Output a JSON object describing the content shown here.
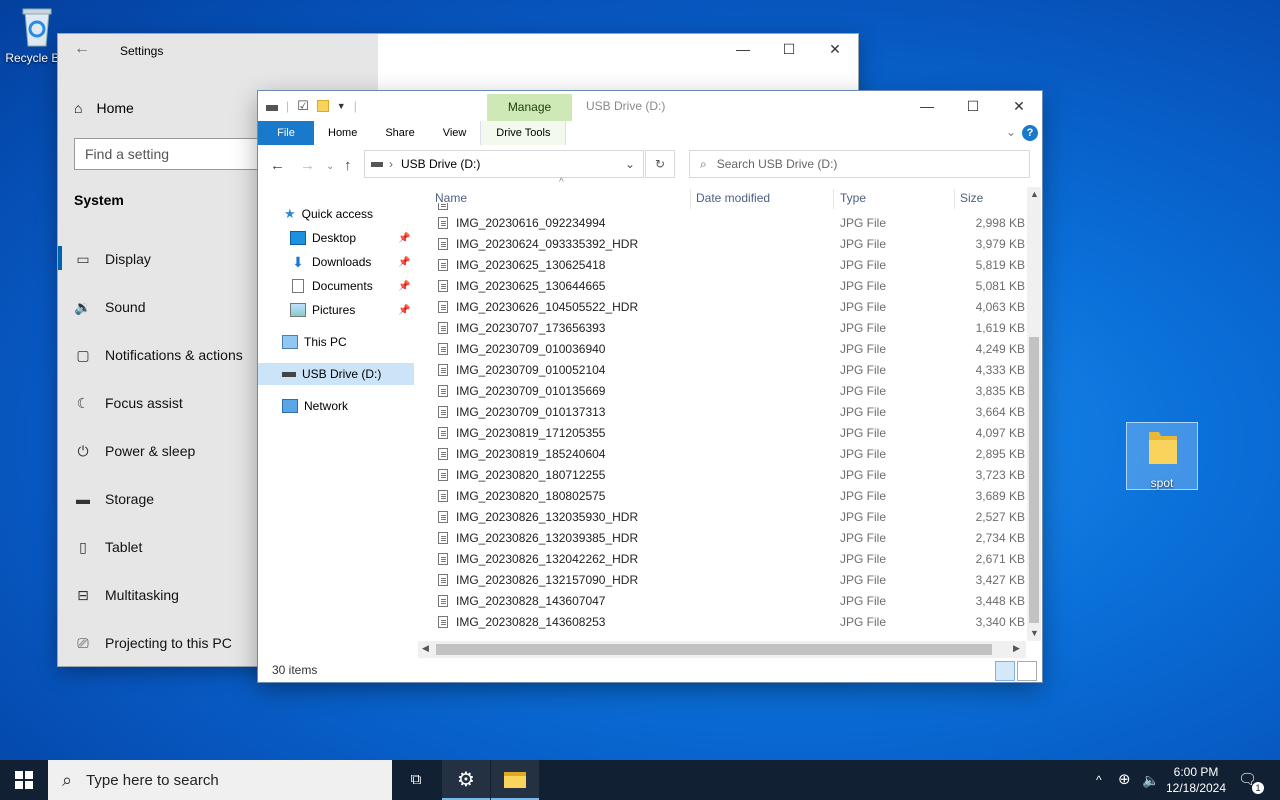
{
  "desktop": {
    "recycle_bin": "Recycle Bin",
    "folder_spot": "spot"
  },
  "settings": {
    "title": "Settings",
    "home": "Home",
    "search_placeholder": "Find a setting",
    "section": "System",
    "items": [
      {
        "label": "Display",
        "icon": "display-icon"
      },
      {
        "label": "Sound",
        "icon": "sound-icon"
      },
      {
        "label": "Notifications & actions",
        "icon": "notifications-icon"
      },
      {
        "label": "Focus assist",
        "icon": "focus-assist-icon"
      },
      {
        "label": "Power & sleep",
        "icon": "power-icon"
      },
      {
        "label": "Storage",
        "icon": "storage-icon"
      },
      {
        "label": "Tablet",
        "icon": "tablet-icon"
      },
      {
        "label": "Multitasking",
        "icon": "multitasking-icon"
      },
      {
        "label": "Projecting to this PC",
        "icon": "projecting-icon"
      }
    ],
    "selected": "Display"
  },
  "explorer": {
    "title": "USB Drive (D:)",
    "context_tab": "Manage",
    "tabs": [
      "File",
      "Home",
      "Share",
      "View",
      "Drive Tools"
    ],
    "address": "USB Drive (D:)",
    "search_placeholder": "Search USB Drive (D:)",
    "nav": {
      "quick_access": "Quick access",
      "desktop": "Desktop",
      "downloads": "Downloads",
      "documents": "Documents",
      "pictures": "Pictures",
      "this_pc": "This PC",
      "usb": "USB Drive (D:)",
      "network": "Network"
    },
    "columns": {
      "name": "Name",
      "date": "Date modified",
      "type": "Type",
      "size": "Size"
    },
    "files": [
      {
        "name": "IMG_20230616_092234994",
        "type": "JPG File",
        "size": "2,998 KB"
      },
      {
        "name": "IMG_20230624_093335392_HDR",
        "type": "JPG File",
        "size": "3,979 KB"
      },
      {
        "name": "IMG_20230625_130625418",
        "type": "JPG File",
        "size": "5,819 KB"
      },
      {
        "name": "IMG_20230625_130644665",
        "type": "JPG File",
        "size": "5,081 KB"
      },
      {
        "name": "IMG_20230626_104505522_HDR",
        "type": "JPG File",
        "size": "4,063 KB"
      },
      {
        "name": "IMG_20230707_173656393",
        "type": "JPG File",
        "size": "1,619 KB"
      },
      {
        "name": "IMG_20230709_010036940",
        "type": "JPG File",
        "size": "4,249 KB"
      },
      {
        "name": "IMG_20230709_010052104",
        "type": "JPG File",
        "size": "4,333 KB"
      },
      {
        "name": "IMG_20230709_010135669",
        "type": "JPG File",
        "size": "3,835 KB"
      },
      {
        "name": "IMG_20230709_010137313",
        "type": "JPG File",
        "size": "3,664 KB"
      },
      {
        "name": "IMG_20230819_171205355",
        "type": "JPG File",
        "size": "4,097 KB"
      },
      {
        "name": "IMG_20230819_185240604",
        "type": "JPG File",
        "size": "2,895 KB"
      },
      {
        "name": "IMG_20230820_180712255",
        "type": "JPG File",
        "size": "3,723 KB"
      },
      {
        "name": "IMG_20230820_180802575",
        "type": "JPG File",
        "size": "3,689 KB"
      },
      {
        "name": "IMG_20230826_132035930_HDR",
        "type": "JPG File",
        "size": "2,527 KB"
      },
      {
        "name": "IMG_20230826_132039385_HDR",
        "type": "JPG File",
        "size": "2,734 KB"
      },
      {
        "name": "IMG_20230826_132042262_HDR",
        "type": "JPG File",
        "size": "2,671 KB"
      },
      {
        "name": "IMG_20230826_132157090_HDR",
        "type": "JPG File",
        "size": "3,427 KB"
      },
      {
        "name": "IMG_20230828_143607047",
        "type": "JPG File",
        "size": "3,448 KB"
      },
      {
        "name": "IMG_20230828_143608253",
        "type": "JPG File",
        "size": "3,340 KB"
      }
    ],
    "status": "30 items"
  },
  "taskbar": {
    "search_placeholder": "Type here to search",
    "time": "6:00 PM",
    "date": "12/18/2024",
    "notification_count": "1"
  },
  "colors": {
    "accent": "#0078d7",
    "file_tab": "#1979ca",
    "manage_tab": "#cfe9b6",
    "taskbar": "#122033"
  }
}
